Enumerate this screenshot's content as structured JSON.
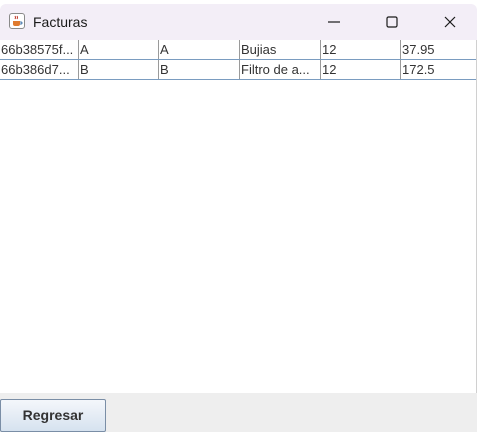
{
  "window": {
    "title": "Facturas",
    "app_icon": "java-cup-icon",
    "controls": [
      "minimize-icon",
      "maximize-icon",
      "close-icon"
    ]
  },
  "table": {
    "rows": [
      [
        "66b38575f...",
        "A",
        "A",
        "Bujias",
        "12",
        "37.95"
      ],
      [
        "66b386d7...",
        "B",
        "B",
        "Filtro de a...",
        "12",
        "172.5"
      ]
    ]
  },
  "footer": {
    "back_label": "Regresar"
  },
  "colors": {
    "titlebar": "#f3eef7",
    "grid_line": "#7a9cc0",
    "footer_bg": "#eeeeee"
  }
}
